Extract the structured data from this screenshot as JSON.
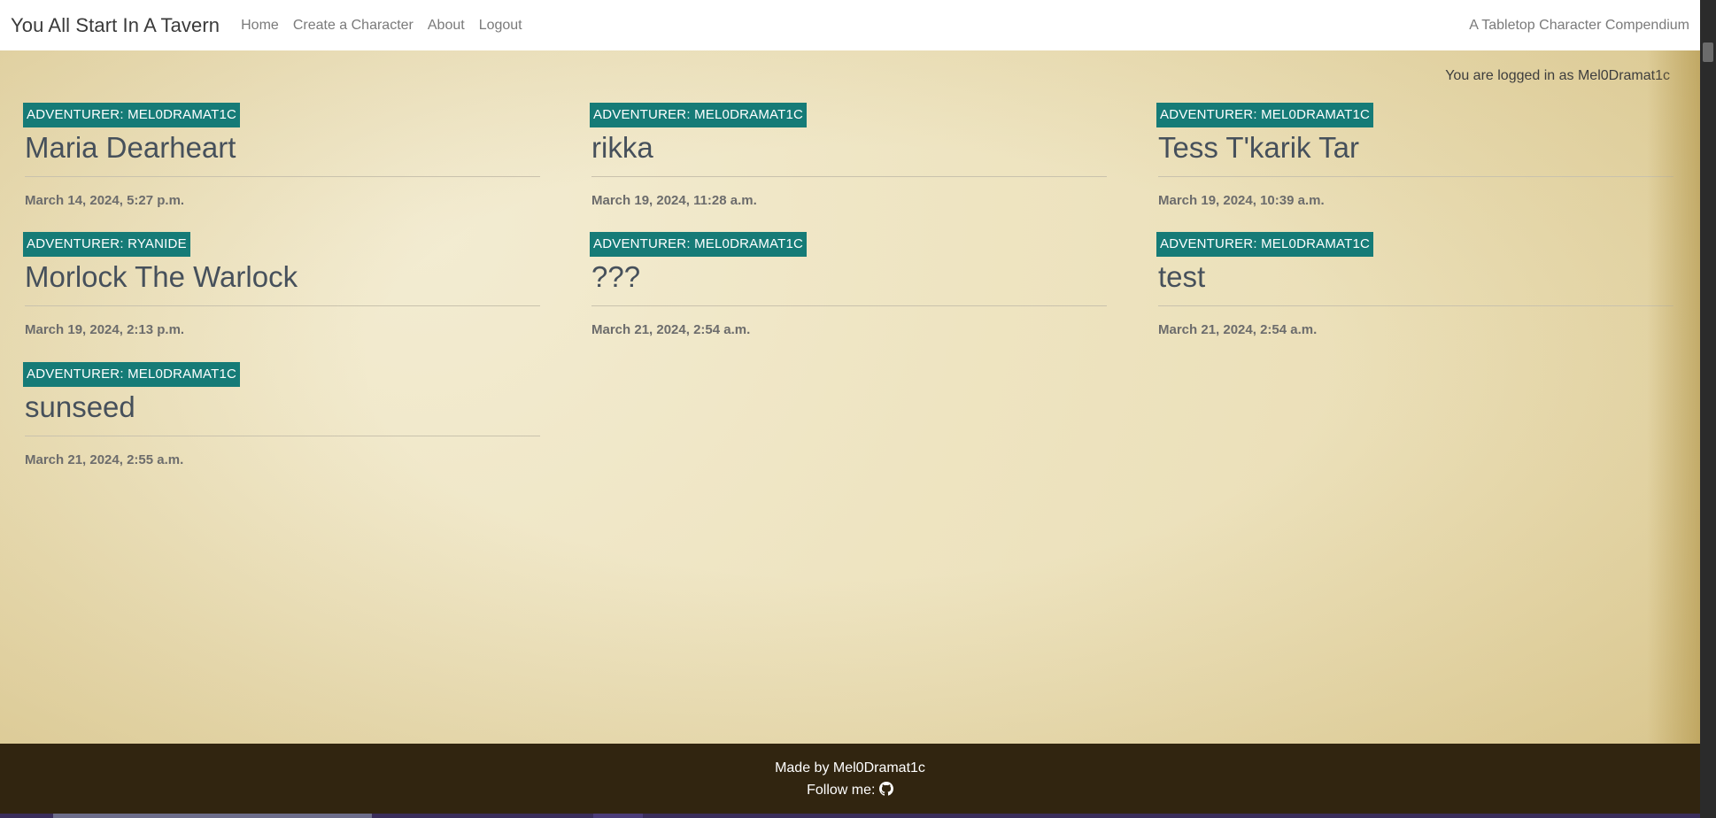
{
  "navbar": {
    "brand": "You All Start In A Tavern",
    "links": [
      "Home",
      "Create a Character",
      "About",
      "Logout"
    ],
    "tagline": "A Tabletop Character Compendium"
  },
  "status": {
    "login_text": "You are logged in as Mel0Dramat1c"
  },
  "characters": [
    {
      "badge": "ADVENTURER: MEL0DRAMAT1C",
      "name": "Maria Dearheart",
      "date": "March 14, 2024, 5:27 p.m."
    },
    {
      "badge": "ADVENTURER: MEL0DRAMAT1C",
      "name": "rikka",
      "date": "March 19, 2024, 11:28 a.m."
    },
    {
      "badge": "ADVENTURER: MEL0DRAMAT1C",
      "name": "Tess T'karik Tar",
      "date": "March 19, 2024, 10:39 a.m."
    },
    {
      "badge": "ADVENTURER: RYANIDE",
      "name": "Morlock The Warlock",
      "date": "March 19, 2024, 2:13 p.m."
    },
    {
      "badge": "ADVENTURER: MEL0DRAMAT1C",
      "name": "???",
      "date": "March 21, 2024, 2:54 a.m."
    },
    {
      "badge": "ADVENTURER: MEL0DRAMAT1C",
      "name": "test",
      "date": "March 21, 2024, 2:54 a.m."
    },
    {
      "badge": "ADVENTURER: MEL0DRAMAT1C",
      "name": "sunseed",
      "date": "March 21, 2024, 2:55 a.m."
    }
  ],
  "footer": {
    "made_by": "Made by Mel0Dramat1c",
    "follow": "Follow me:",
    "icon": "github-icon"
  },
  "colors": {
    "badge": "#167b77",
    "footer": "#312510",
    "parchment": "#eee4c1"
  }
}
